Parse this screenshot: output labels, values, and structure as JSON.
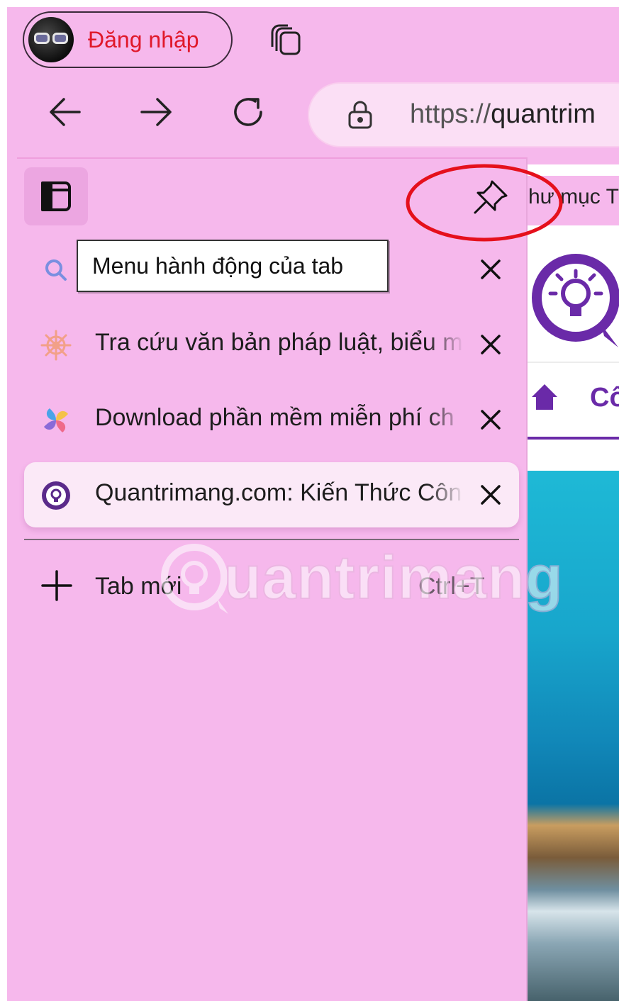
{
  "topbar": {
    "login_label": "Đăng nhập"
  },
  "address_bar": {
    "scheme": "https://",
    "host": "quantrim"
  },
  "bookmarks_bar": {
    "label": "hư mục T"
  },
  "page_behind": {
    "nav_text": "Cô"
  },
  "tooltip": {
    "text": "Menu hành động của tab"
  },
  "tabs": [
    {
      "title": "",
      "favicon": "search-icon",
      "active": false
    },
    {
      "title": "Tra cứu văn bản pháp luật, biểu m",
      "favicon": "helm-icon",
      "active": false
    },
    {
      "title": "Download phần mềm miễn phí ch",
      "favicon": "pinwheel-icon",
      "active": false
    },
    {
      "title": "Quantrimang.com: Kiến Thức Côn",
      "favicon": "quantrimang-icon",
      "active": true
    }
  ],
  "new_tab": {
    "label": "Tab mới",
    "shortcut": "Ctrl+T"
  },
  "watermark": {
    "text": "uantrimang"
  },
  "colors": {
    "background": "#f6b8ec",
    "active_tab": "#fbe9f7",
    "accent_purple": "#6a2aa8",
    "login_red": "#e0182a",
    "annotation_red": "#e5101c"
  }
}
